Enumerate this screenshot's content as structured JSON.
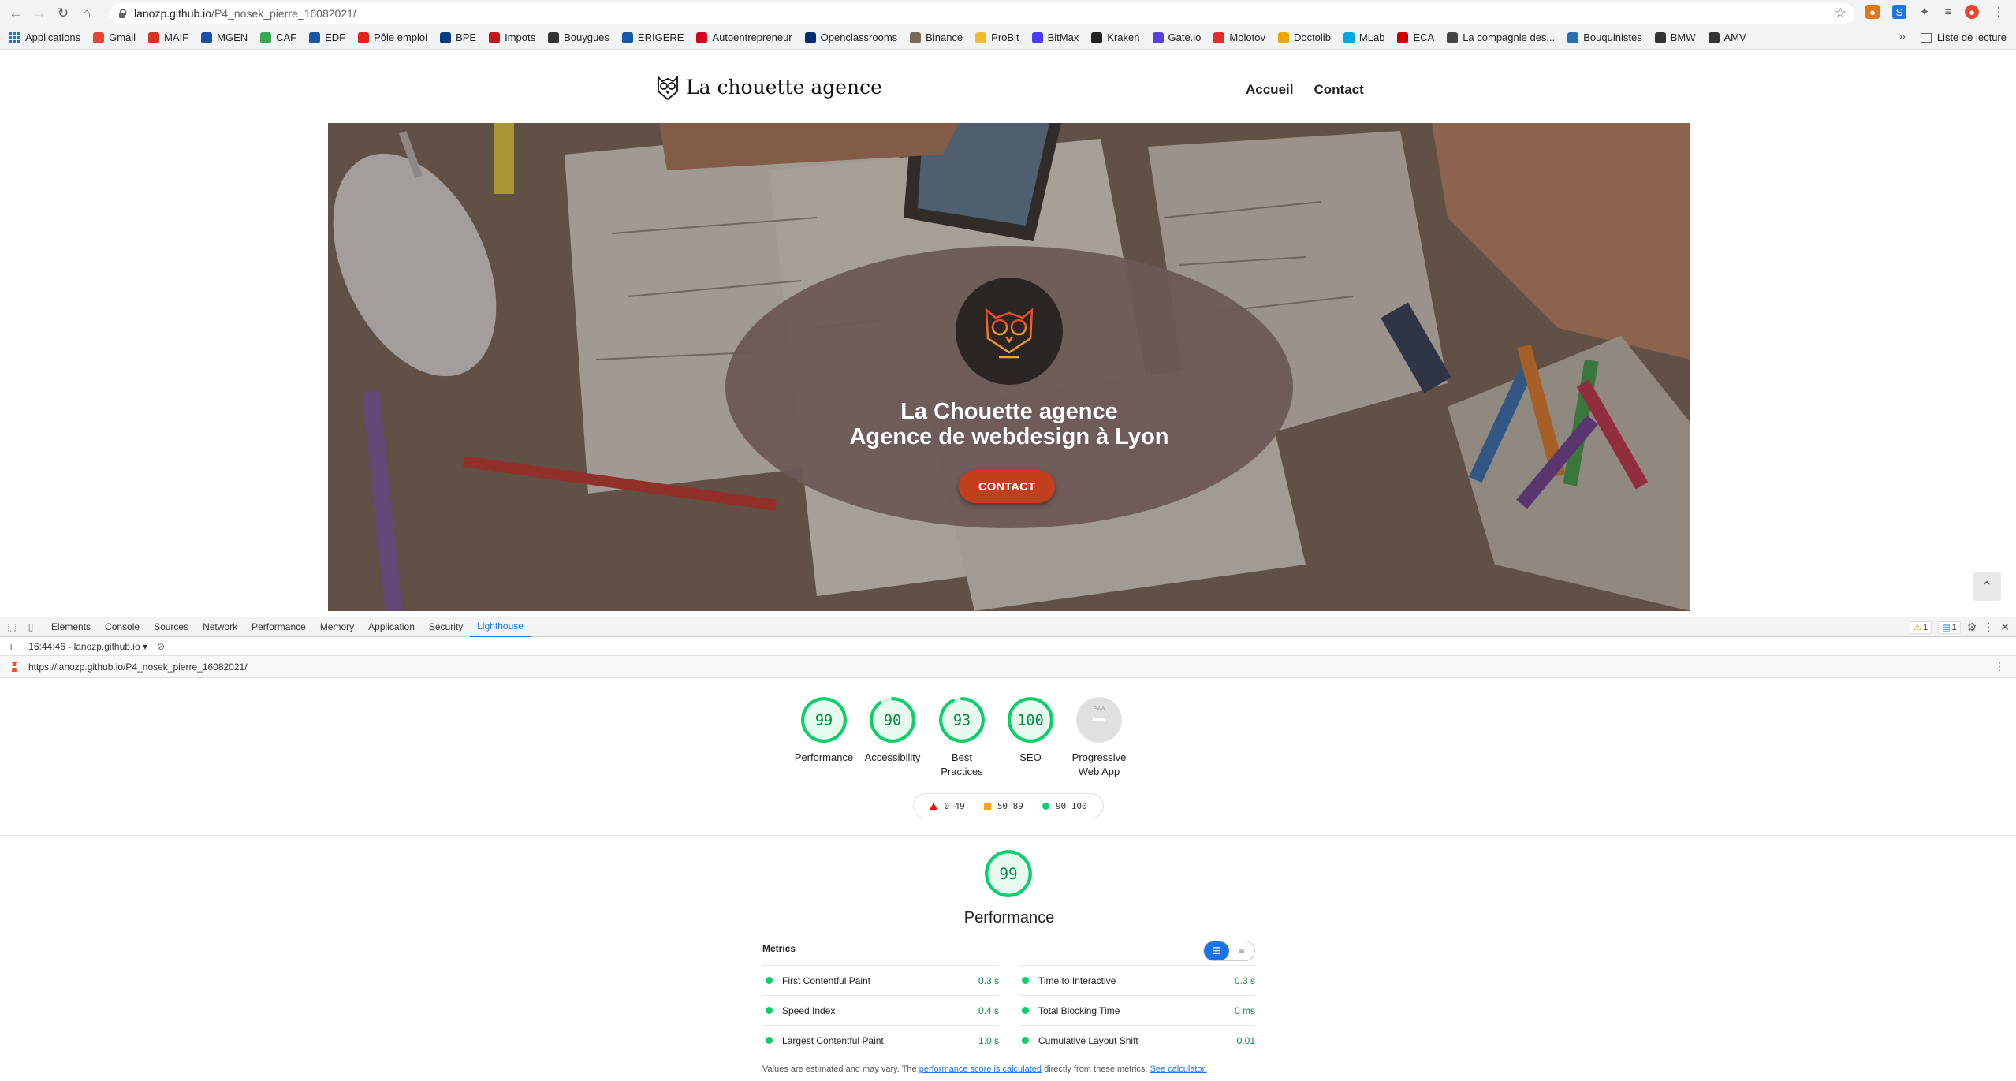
{
  "browser": {
    "url_host": "lanozp.github.io",
    "url_path": "/P4_nosek_pierre_16082021/",
    "bookmarks": [
      "Applications",
      "Gmail",
      "MAIF",
      "MGEN",
      "CAF",
      "EDF",
      "Pôle emploi",
      "BPE",
      "Impots",
      "Bouygues",
      "ERIGERE",
      "Autoentrepreneur",
      "Openclassrooms",
      "Binance",
      "ProBit",
      "BitMax",
      "Kraken",
      "Gate.io",
      "Molotov",
      "Doctolib",
      "MLab",
      "ECA",
      "La compagnie des...",
      "Bouquinistes",
      "BMW",
      "AMV"
    ],
    "bookmark_colors": [
      "#1a73e8",
      "#ea4335",
      "#d93025",
      "#1b4fa8",
      "#34a853",
      "#1a56a8",
      "#e2231a",
      "#003c7e",
      "#c4161c",
      "#333333",
      "#1559a8",
      "#d6001c",
      "#002d72",
      "#7a6a5a",
      "#f3ba2f",
      "#4a3cff",
      "#222222",
      "#5741d9",
      "#e22b2b",
      "#f0a500",
      "#00a6e4",
      "#cc0000",
      "#444444",
      "#2a6fb5",
      "#333333",
      "#333333",
      "#2e7d32"
    ],
    "reading_list": "Liste de lecture"
  },
  "site": {
    "logo_text": "La chouette agence",
    "nav": [
      "Accueil",
      "Contact"
    ],
    "hero_title_line1": "La Chouette agence",
    "hero_title_line2": "Agence de webdesign à Lyon",
    "cta": "CONTACT"
  },
  "devtools": {
    "tabs": [
      "Elements",
      "Console",
      "Sources",
      "Network",
      "Performance",
      "Memory",
      "Application",
      "Security",
      "Lighthouse"
    ],
    "active_tab": "Lighthouse",
    "warnings": "1",
    "messages": "1",
    "report_label": "16:44:46 - lanozp.github.io",
    "report_url": "https://lanozp.github.io/P4_nosek_pierre_16082021/"
  },
  "lighthouse": {
    "pwa_badge": "PWA",
    "categories": [
      {
        "label": "Performance",
        "score": 99
      },
      {
        "label": "Accessibility",
        "score": 90
      },
      {
        "label": "Best Practices",
        "score": 93
      },
      {
        "label": "SEO",
        "score": 100
      },
      {
        "label": "Progressive Web App",
        "score": null
      }
    ],
    "legend": [
      "0–49",
      "50–89",
      "90–100"
    ],
    "performance_title": "Performance",
    "performance_score": 99,
    "metrics_label": "Metrics",
    "metrics": [
      {
        "name": "First Contentful Paint",
        "value": "0.3 s"
      },
      {
        "name": "Time to Interactive",
        "value": "0.3 s"
      },
      {
        "name": "Speed Index",
        "value": "0.4 s"
      },
      {
        "name": "Total Blocking Time",
        "value": "0 ms"
      },
      {
        "name": "Largest Contentful Paint",
        "value": "1.0 s"
      },
      {
        "name": "Cumulative Layout Shift",
        "value": "0.01"
      }
    ],
    "note_prefix": "Values are estimated and may vary. The ",
    "note_link1": "performance score is calculated",
    "note_middle": " directly from these metrics. ",
    "note_link2": "See calculator.",
    "colors": {
      "pass": "#0cce6b",
      "pass_text": "#0a8a42",
      "average": "#ffa400",
      "fail": "#eb0f00",
      "na": "#cccccc"
    }
  }
}
